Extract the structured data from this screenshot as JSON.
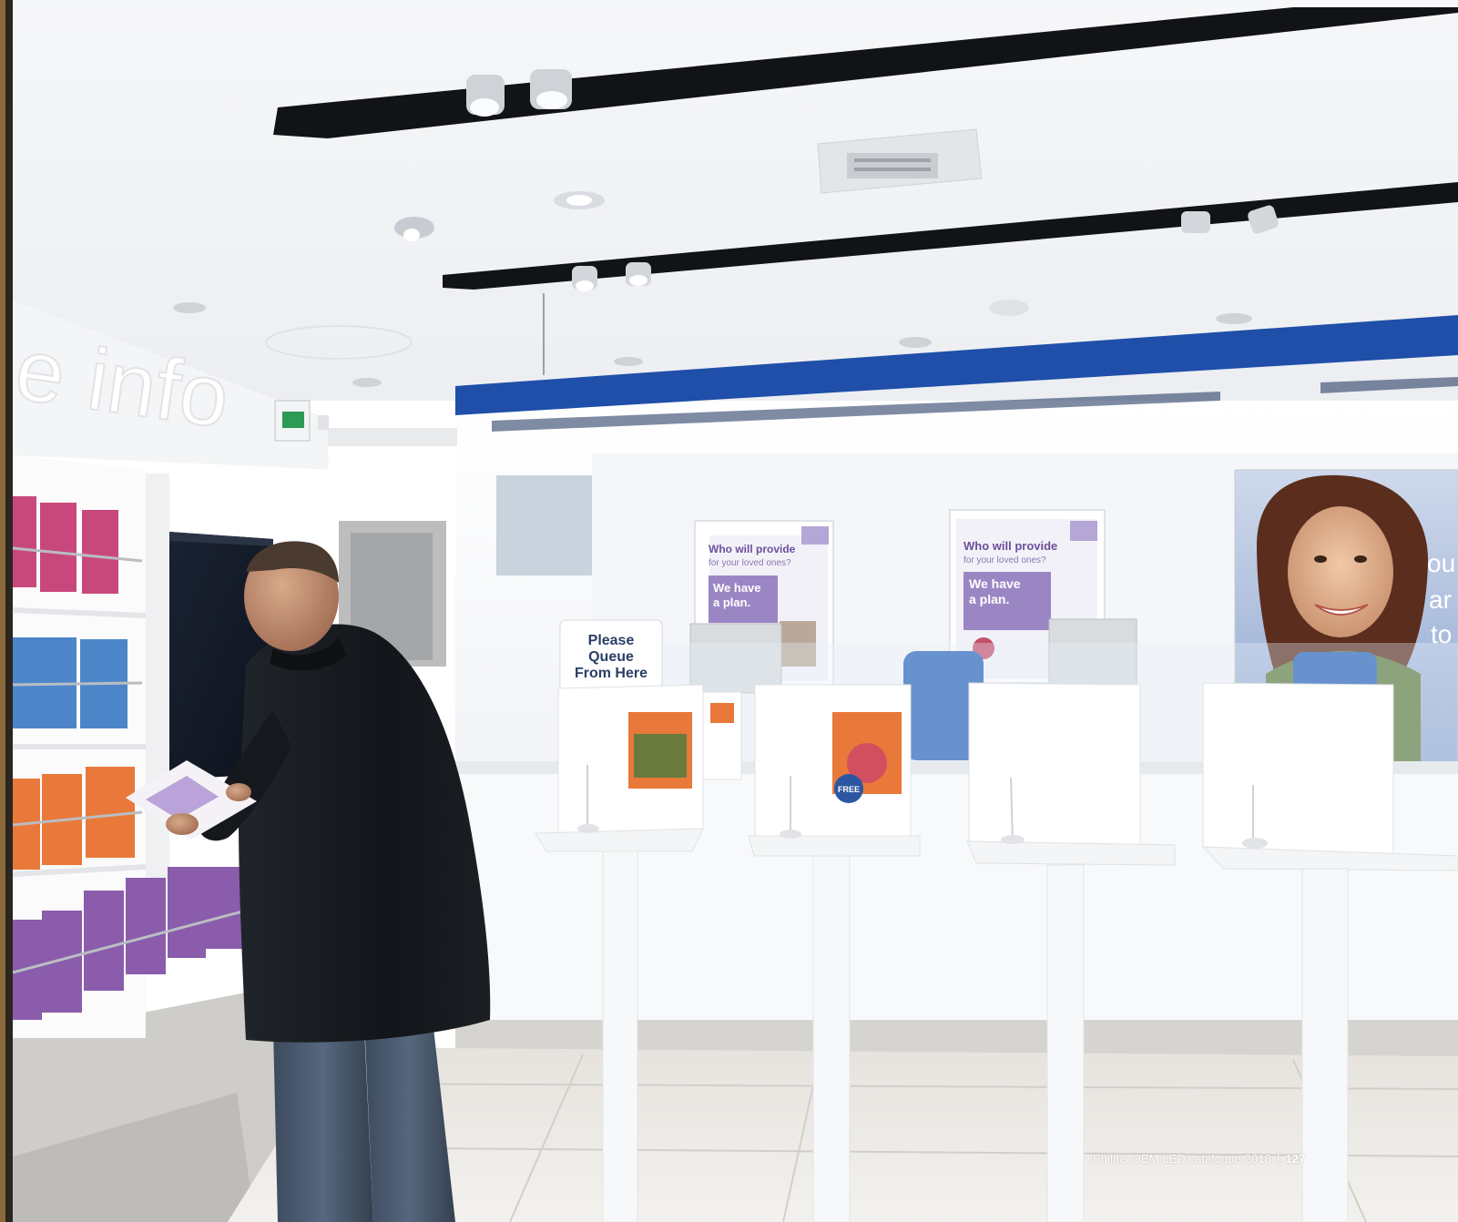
{
  "scene": {
    "wall_sign": "e info",
    "queue_sign": [
      "Please",
      "Queue",
      "From Here"
    ],
    "poster_left": {
      "headline": "Who will provide",
      "subline": "for your loved ones?",
      "panel": [
        "We have",
        "a plan."
      ]
    },
    "poster_middle": {
      "headline": "Who will provide",
      "subline": "for your loved ones?",
      "panel": [
        "We have",
        "a plan."
      ]
    },
    "big_poster_fragment": [
      "ou",
      "ar",
      "to"
    ],
    "leaflet_badge": "FREE"
  },
  "footer": {
    "publication": "Philips OEM LED catalogue 2018",
    "separator": "|",
    "page_number": "127"
  },
  "colors": {
    "brand_blue": "#1f4fa8",
    "ceiling": "#f3f4f6",
    "track": "#121417",
    "floor": "#eceae6",
    "jacket": "#15181c",
    "jeans": "#4a5a70",
    "leaflet_orange": "#e8793a",
    "leaflet_purple": "#8a5cab",
    "leaflet_blue": "#4c86c8",
    "leaflet_pink": "#c9487c"
  }
}
